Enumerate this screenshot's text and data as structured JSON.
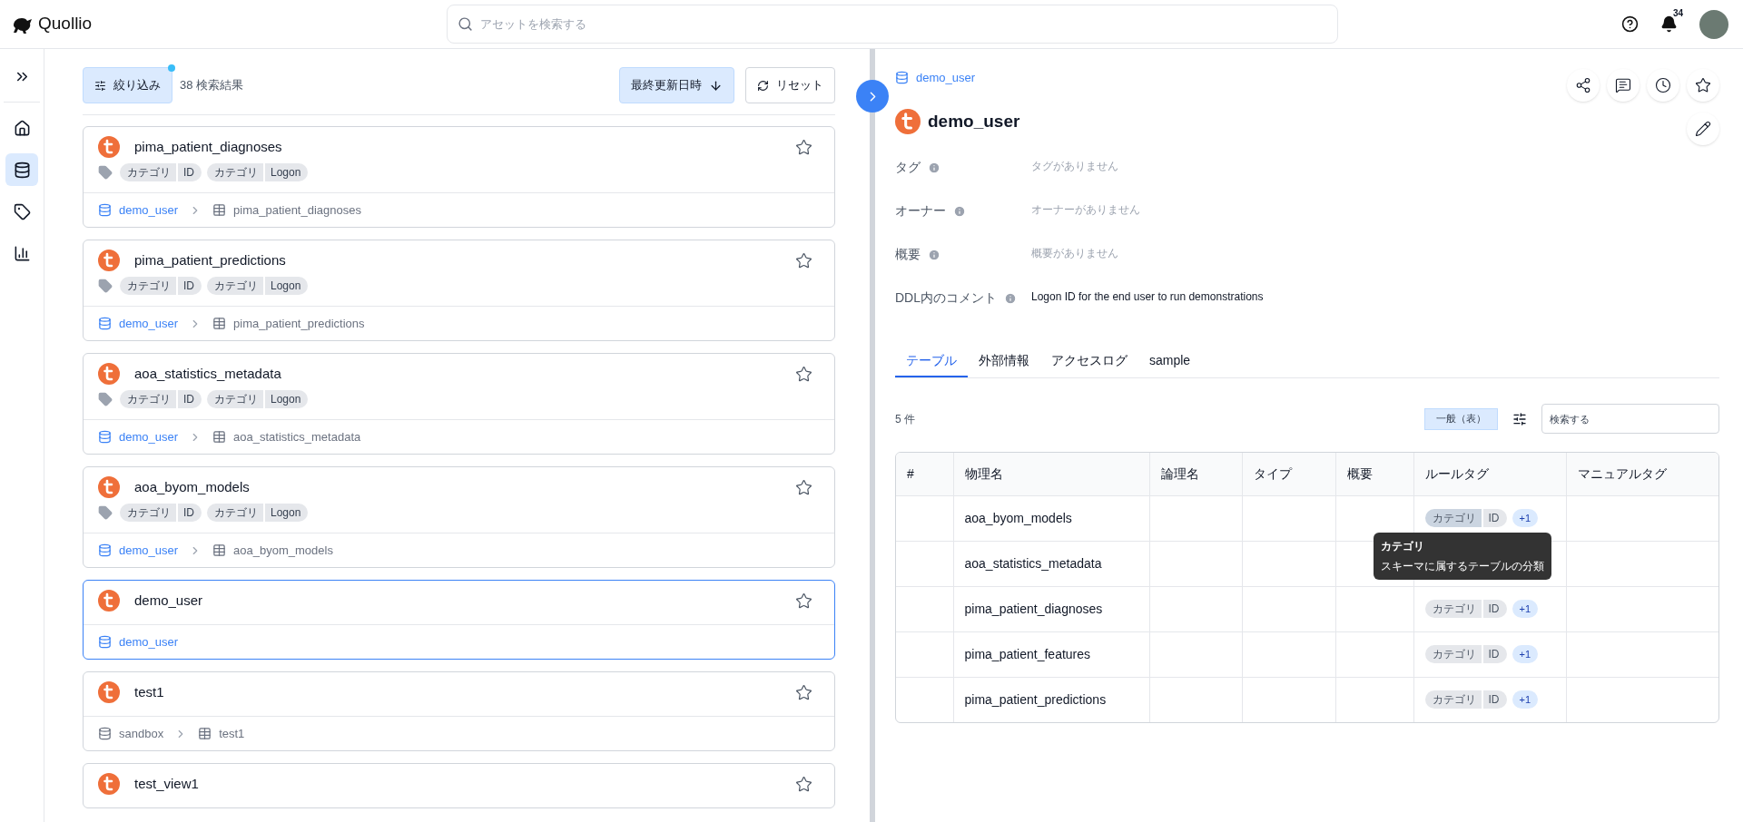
{
  "header": {
    "logo": "Quollio",
    "search": {
      "placeholder": "アセットを検索する"
    },
    "notification_count": "34"
  },
  "sidebar": {
    "items": [
      {
        "kind": "expand",
        "selected": false
      },
      {
        "kind": "home",
        "selected": false
      },
      {
        "kind": "database",
        "selected": true
      },
      {
        "kind": "tag",
        "selected": false
      },
      {
        "kind": "chart",
        "selected": false
      }
    ]
  },
  "list": {
    "filter_button": "絞り込み",
    "filter_active": true,
    "result_count": "38 検索結果",
    "sort_button": "最終更新日時",
    "reset_button": "リセット",
    "cards": [
      {
        "title": "pima_patient_diagnoses",
        "selected": false,
        "tags": [
          "カテゴリ",
          "ID",
          "カテゴリ",
          "Logon"
        ],
        "path": [
          {
            "label": "demo_user",
            "kind": "schema",
            "link": true
          },
          {
            "label": "pima_patient_diagnoses",
            "kind": "table",
            "link": false
          }
        ]
      },
      {
        "title": "pima_patient_predictions",
        "selected": false,
        "tags": [
          "カテゴリ",
          "ID",
          "カテゴリ",
          "Logon"
        ],
        "path": [
          {
            "label": "demo_user",
            "kind": "schema",
            "link": true
          },
          {
            "label": "pima_patient_predictions",
            "kind": "table",
            "link": false
          }
        ]
      },
      {
        "title": "aoa_statistics_metadata",
        "selected": false,
        "tags": [
          "カテゴリ",
          "ID",
          "カテゴリ",
          "Logon"
        ],
        "path": [
          {
            "label": "demo_user",
            "kind": "schema",
            "link": true
          },
          {
            "label": "aoa_statistics_metadata",
            "kind": "table",
            "link": false
          }
        ]
      },
      {
        "title": "aoa_byom_models",
        "selected": false,
        "tags": [
          "カテゴリ",
          "ID",
          "カテゴリ",
          "Logon"
        ],
        "path": [
          {
            "label": "demo_user",
            "kind": "schema",
            "link": true
          },
          {
            "label": "aoa_byom_models",
            "kind": "table",
            "link": false
          }
        ]
      },
      {
        "title": "demo_user",
        "selected": true,
        "path": [
          {
            "label": "demo_user",
            "kind": "schema",
            "link": true
          }
        ]
      },
      {
        "title": "test1",
        "selected": false,
        "path": [
          {
            "label": "sandbox",
            "kind": "schema",
            "link": false
          },
          {
            "label": "test1",
            "kind": "table",
            "link": false
          }
        ]
      },
      {
        "title": "test_view1",
        "selected": false
      }
    ]
  },
  "detail": {
    "breadcrumb": "demo_user",
    "title": "demo_user",
    "fields": [
      {
        "label": "タグ",
        "value": "タグがありません",
        "empty": true
      },
      {
        "label": "オーナー",
        "value": "オーナーがありません",
        "empty": true
      },
      {
        "label": "概要",
        "value": "概要がありません",
        "empty": true
      },
      {
        "label": "DDL内のコメント",
        "value": "Logon ID for the end user to run demonstrations",
        "empty": false
      }
    ],
    "tabs": [
      {
        "label": "テーブル",
        "selected": true
      },
      {
        "label": "外部情報",
        "selected": false
      },
      {
        "label": "アクセスログ",
        "selected": false
      },
      {
        "label": "sample",
        "selected": false
      }
    ],
    "count": "5 件",
    "view_button": "一般（表）",
    "search": {
      "placeholder": "検索する"
    },
    "table": {
      "columns": [
        "#",
        "物理名",
        "論理名",
        "タイプ",
        "概要",
        "ルールタグ",
        "マニュアルタグ"
      ],
      "rows": [
        {
          "name": "aoa_byom_models",
          "tags": [
            "カテゴリ",
            "ID"
          ],
          "more": "+1",
          "hovered": true
        },
        {
          "name": "aoa_statistics_metadata",
          "hovered": false
        },
        {
          "name": "pima_patient_diagnoses",
          "tags": [
            "カテゴリ",
            "ID"
          ],
          "more": "+1",
          "hovered": false
        },
        {
          "name": "pima_patient_features",
          "tags": [
            "カテゴリ",
            "ID"
          ],
          "more": "+1",
          "hovered": false
        },
        {
          "name": "pima_patient_predictions",
          "tags": [
            "カテゴリ",
            "ID"
          ],
          "more": "+1",
          "hovered": false
        }
      ]
    },
    "tooltip": {
      "title": "カテゴリ",
      "text": "スキーマに属するテーブルの分類"
    }
  }
}
